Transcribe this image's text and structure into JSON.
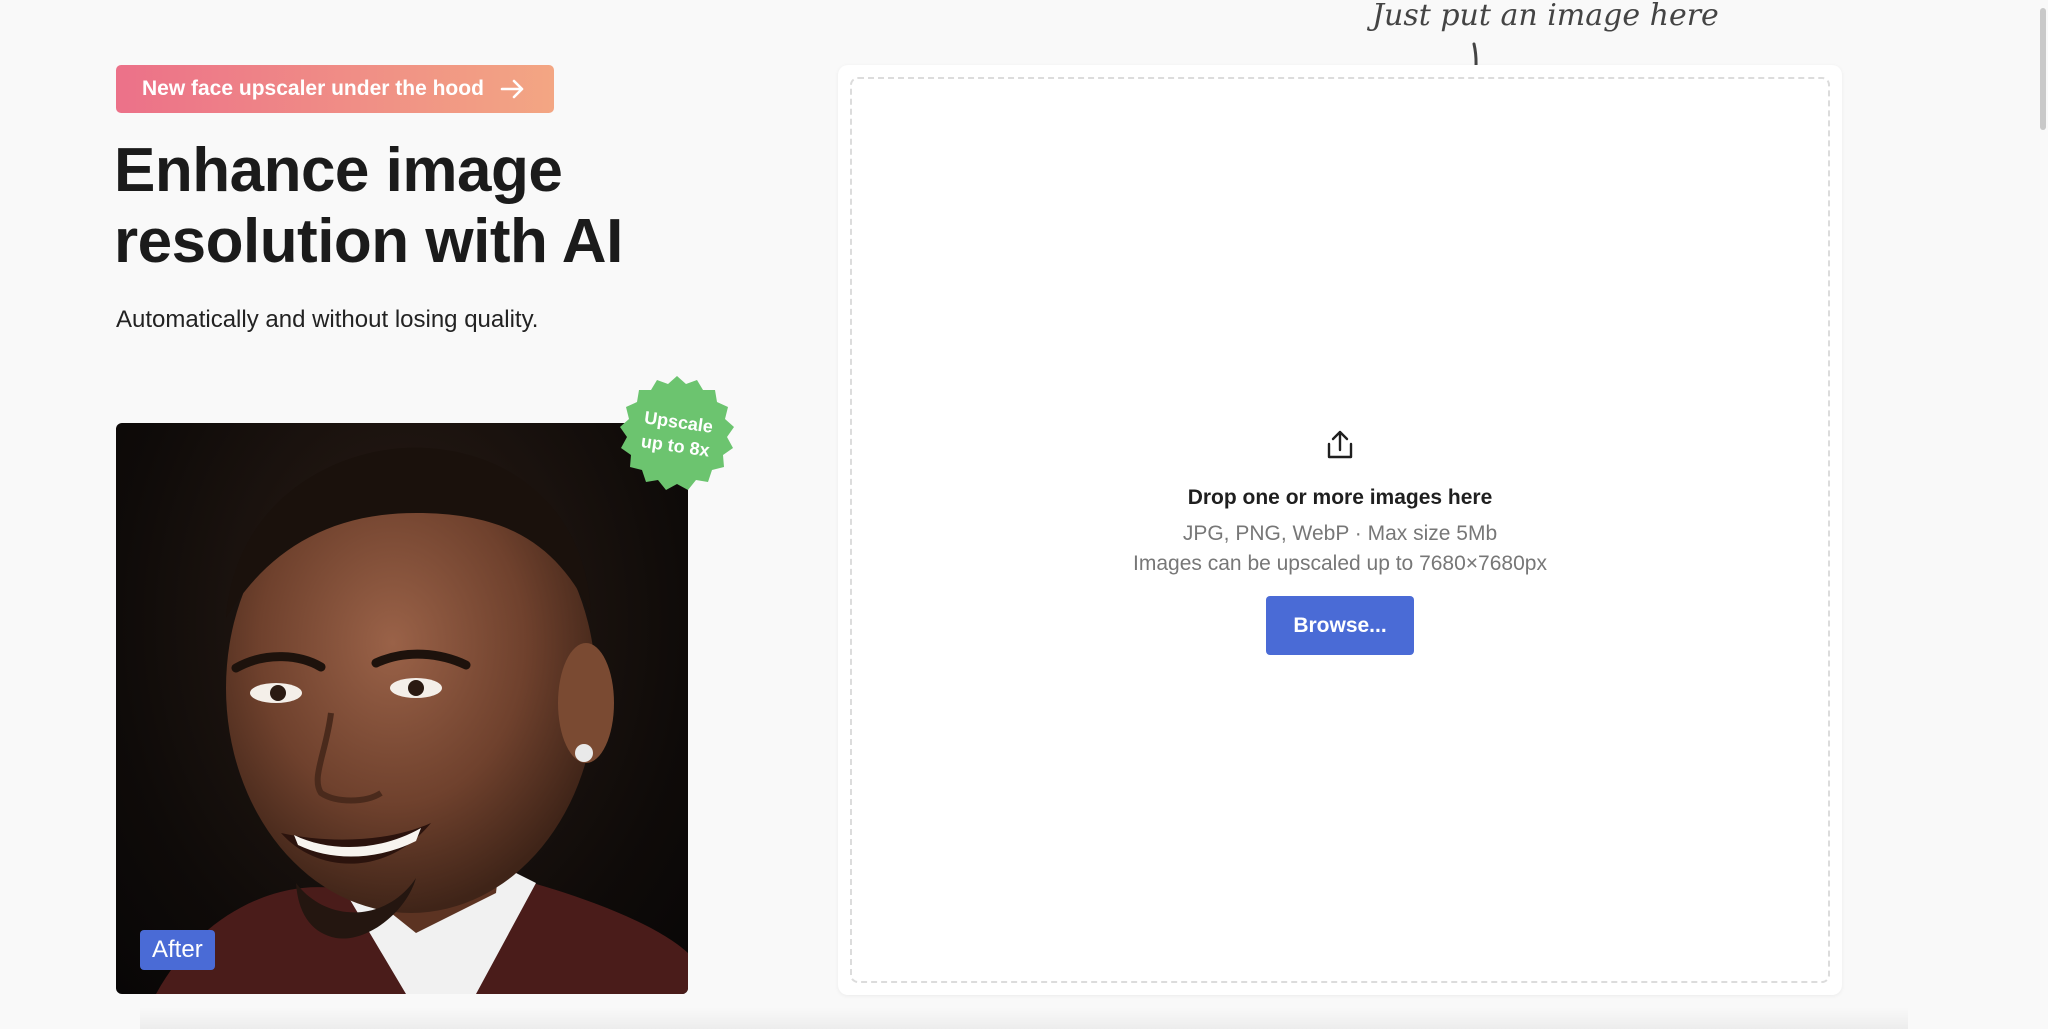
{
  "promo": {
    "label": "New face upscaler under the hood",
    "gradient_start": "#ec7189",
    "gradient_end": "#f3a683",
    "icon": "arrow-right-icon"
  },
  "hero": {
    "title_line1": "Enhance image",
    "title_line2": "resolution with AI",
    "subtitle": "Automatically and without losing quality."
  },
  "sample": {
    "label": "After",
    "badge_line1": "Upscale",
    "badge_line2": "up to 8x",
    "badge_color": "#6cc46f"
  },
  "dropzone": {
    "icon": "upload-icon",
    "title": "Drop one or more images here",
    "formats": "JPG, PNG, WebP · Max size 5Mb",
    "limit": "Images can be upscaled up to 7680×7680px",
    "browse_label": "Browse...",
    "accent": "#4a6bd6"
  },
  "hint": {
    "text": "Just put an image here",
    "icon": "curved-arrow-down-icon"
  }
}
